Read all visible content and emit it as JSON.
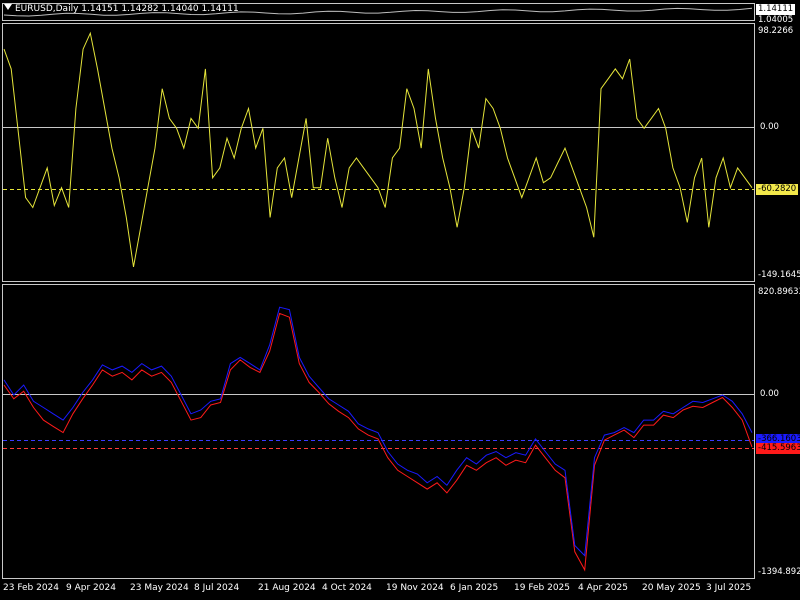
{
  "header": {
    "symbol_title": "EURUSD,Daily  1.14151 1.14282 1.14040 1.14111"
  },
  "price_pane": {
    "current_price_tag": "1.14111",
    "max_label": "1.04005"
  },
  "oscillator_pane": {
    "max_label": "98.2266",
    "zero_label": "0.00",
    "level_tag": "-60.2820",
    "min_label": "-149.1645",
    "line_color": "#e5e53a",
    "level_color": "#e5e53a"
  },
  "dual_pane": {
    "max_label": "820.89633",
    "zero_label": "0.00",
    "blue_tag": "-366.1603",
    "red_tag": "-415.5963",
    "min_label": "-1394.8927",
    "blue_color": "#1a1aff",
    "red_color": "#ff1a1a"
  },
  "x_axis": {
    "labels": [
      "23 Feb 2024",
      "9 Apr 2024",
      "23 May 2024",
      "8 Jul 2024",
      "21 Aug 2024",
      "4 Oct 2024",
      "19 Nov 2024",
      "6 Jan 2025",
      "19 Feb 2025",
      "4 Apr 2025",
      "20 May 2025",
      "3 Jul 2025"
    ]
  },
  "chart_data": [
    {
      "type": "line",
      "title": "",
      "ylim": [
        -149.1645,
        98.2266
      ],
      "reference_levels": [
        0,
        -60.282
      ],
      "series": [
        {
          "values": [
            80,
            60,
            -5,
            -70,
            -80,
            -60,
            -40,
            -78,
            -60,
            -80,
            20,
            80,
            96,
            60,
            20,
            -20,
            -50,
            -90,
            -140,
            -100,
            -60,
            -20,
            40,
            10,
            0,
            -20,
            10,
            0,
            60,
            -50,
            -40,
            -10,
            -30,
            0,
            20,
            -20,
            0,
            -90,
            -40,
            -30,
            -70,
            -30,
            10,
            -60,
            -60,
            -10,
            -50,
            -80,
            -40,
            -30,
            -40,
            -50,
            -60,
            -80,
            -30,
            -20,
            40,
            20,
            -20,
            60,
            10,
            -30,
            -60,
            -100,
            -60,
            0,
            -20,
            30,
            20,
            0,
            -30,
            -50,
            -70,
            -50,
            -30,
            -55,
            -50,
            -35,
            -20,
            -40,
            -60,
            -80,
            -110,
            40,
            50,
            60,
            50,
            70,
            10,
            0,
            10,
            20,
            0,
            -40,
            -60,
            -95,
            -50,
            -30,
            -100,
            -50,
            -30,
            -60,
            -40,
            -50,
            -60
          ]
        }
      ]
    },
    {
      "type": "line",
      "title": "",
      "ylim": [
        -1394.8927,
        820.89633
      ],
      "reference_levels": [
        0
      ],
      "series": [
        {
          "values": [
            120,
            0,
            80,
            -50,
            -100,
            -150,
            -200,
            -100,
            20,
            120,
            240,
            200,
            230,
            180,
            250,
            200,
            230,
            150,
            0,
            -150,
            -120,
            -50,
            -30,
            250,
            300,
            250,
            200,
            400,
            700,
            680,
            300,
            150,
            60,
            -30,
            -80,
            -130,
            -230,
            -270,
            -300,
            -450,
            -550,
            -600,
            -630,
            -700,
            -650,
            -720,
            -600,
            -500,
            -550,
            -480,
            -450,
            -500,
            -460,
            -480,
            -350,
            -450,
            -550,
            -600,
            -1200,
            -1280,
            -500,
            -320,
            -300,
            -260,
            -300,
            -200,
            -200,
            -130,
            -150,
            -100,
            -50,
            -60,
            -30,
            0,
            -50,
            -150,
            -300
          ]
        },
        {
          "values": [
            80,
            -30,
            30,
            -100,
            -200,
            -250,
            -300,
            -150,
            -30,
            80,
            200,
            150,
            180,
            120,
            200,
            150,
            180,
            100,
            -50,
            -200,
            -180,
            -80,
            -60,
            200,
            280,
            220,
            180,
            350,
            650,
            620,
            250,
            100,
            20,
            -70,
            -130,
            -180,
            -270,
            -320,
            -350,
            -500,
            -600,
            -650,
            -700,
            -750,
            -700,
            -780,
            -680,
            -560,
            -600,
            -540,
            -500,
            -560,
            -520,
            -540,
            -400,
            -500,
            -600,
            -660,
            -1250,
            -1394,
            -560,
            -360,
            -320,
            -280,
            -340,
            -240,
            -240,
            -160,
            -180,
            -120,
            -90,
            -100,
            -60,
            -20,
            -100,
            -200,
            -415
          ]
        }
      ]
    }
  ]
}
